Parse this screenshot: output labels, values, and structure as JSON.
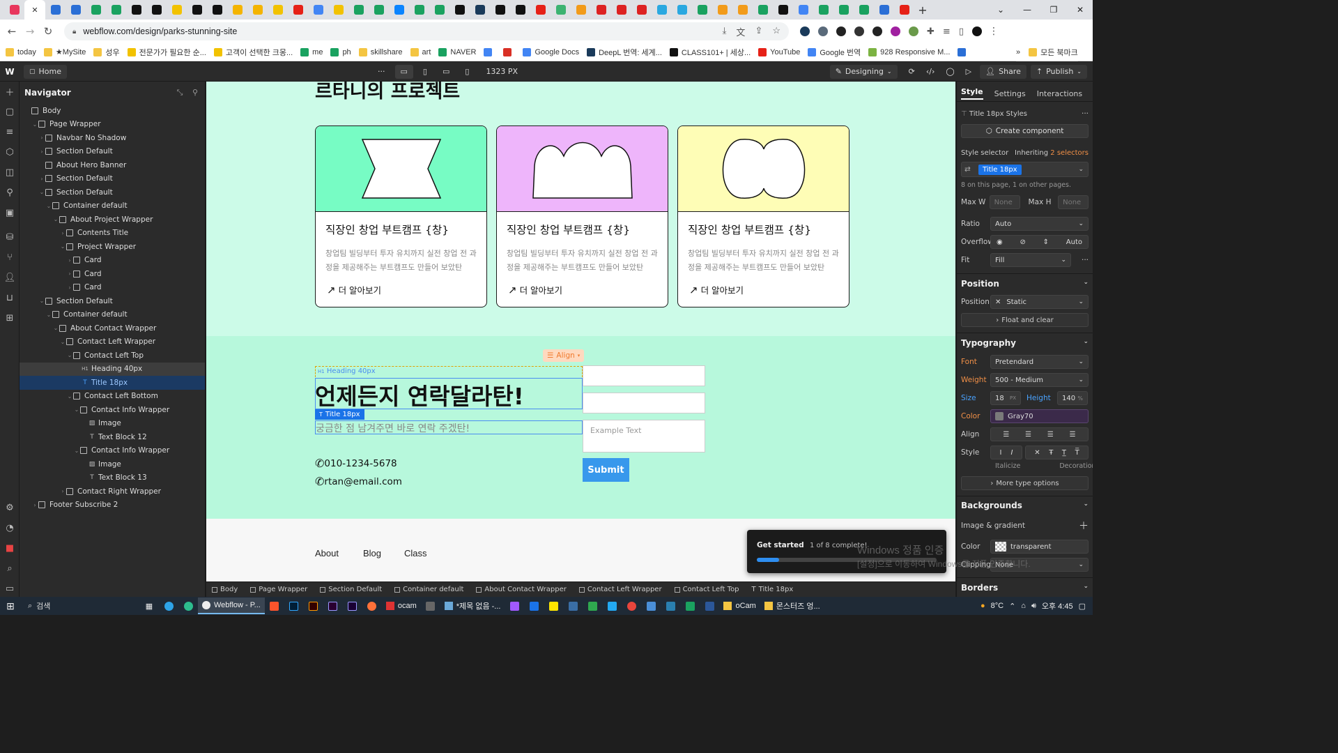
{
  "browser": {
    "url": "webflow.com/design/parks-stunning-site",
    "bookmarks": [
      "today",
      "★MySite",
      "성우",
      "전문가가 필요한 순...",
      "고객이 선택한 크몽...",
      "me",
      "ph",
      "skillshare",
      "art",
      "NAVER",
      "",
      "",
      "Google Docs",
      "DeepL 번역: 세계...",
      "CLASS101+ | 세상...",
      "YouTube",
      "Google 번역",
      "928 Responsive M...",
      ""
    ],
    "bookmarks_more": "»",
    "bookmarks_folder": "모든 북마크",
    "tab_colors": [
      "#e8365d",
      "#e8365d",
      "#2b6fd6",
      "#2b6fd6",
      "#1aa260",
      "#1aa260",
      "#111",
      "#111",
      "#f2c200",
      "#111",
      "#111",
      "#f4b400",
      "#f4b400",
      "#f2c200",
      "#e62117",
      "#4285f4",
      "#f2c200",
      "#1aa260",
      "#1aa260",
      "#0a84ff",
      "#1aa260",
      "#1aa260",
      "#111",
      "#1a3a5a",
      "#111",
      "#111",
      "#e62117",
      "#3cb371",
      "#f29b1a",
      "#d22",
      "#d22",
      "#d22",
      "#2aa8e0",
      "#2aa8e0",
      "#1aa260",
      "#f29b1a",
      "#f29b1a",
      "#1aa260",
      "#111",
      "#4285f4",
      "#1aa260",
      "#1aa260",
      "#1aa260",
      "#2b6fd6",
      "#e62117"
    ]
  },
  "webflow": {
    "home_label": "Home",
    "more": "···",
    "width_label": "1323 PX",
    "mode_label": "Designing",
    "share_label": "Share",
    "publish_label": "Publish"
  },
  "navigator": {
    "title": "Navigator",
    "items": [
      {
        "label": "Body",
        "depth": 0,
        "caret": "",
        "kind": "box"
      },
      {
        "label": "Page Wrapper",
        "depth": 1,
        "caret": "⌄",
        "kind": "box"
      },
      {
        "label": "Navbar No Shadow",
        "depth": 2,
        "caret": "›",
        "kind": "box"
      },
      {
        "label": "Section Default",
        "depth": 2,
        "caret": "›",
        "kind": "box"
      },
      {
        "label": "About Hero Banner",
        "depth": 2,
        "caret": "",
        "kind": "box"
      },
      {
        "label": "Section Default",
        "depth": 2,
        "caret": "›",
        "kind": "box"
      },
      {
        "label": "Section Default",
        "depth": 2,
        "caret": "⌄",
        "kind": "box"
      },
      {
        "label": "Container default",
        "depth": 3,
        "caret": "⌄",
        "kind": "box"
      },
      {
        "label": "About Project Wrapper",
        "depth": 4,
        "caret": "⌄",
        "kind": "box"
      },
      {
        "label": "Contents Title",
        "depth": 5,
        "caret": "›",
        "kind": "box"
      },
      {
        "label": "Project Wrapper",
        "depth": 5,
        "caret": "⌄",
        "kind": "box"
      },
      {
        "label": "Card",
        "depth": 6,
        "caret": "›",
        "kind": "box"
      },
      {
        "label": "Card",
        "depth": 6,
        "caret": "›",
        "kind": "box"
      },
      {
        "label": "Card",
        "depth": 6,
        "caret": "›",
        "kind": "box"
      },
      {
        "label": "Section Default",
        "depth": 2,
        "caret": "⌄",
        "kind": "box"
      },
      {
        "label": "Container default",
        "depth": 3,
        "caret": "⌄",
        "kind": "box"
      },
      {
        "label": "About Contact Wrapper",
        "depth": 4,
        "caret": "⌄",
        "kind": "box"
      },
      {
        "label": "Contact Left Wrapper",
        "depth": 5,
        "caret": "⌄",
        "kind": "box"
      },
      {
        "label": "Contact Left Top",
        "depth": 6,
        "caret": "⌄",
        "kind": "box"
      },
      {
        "label": "Heading 40px",
        "depth": 7,
        "caret": "",
        "kind": "H1",
        "state": "parent"
      },
      {
        "label": "Title 18px",
        "depth": 7,
        "caret": "",
        "kind": "T",
        "state": "selected"
      },
      {
        "label": "Contact Left Bottom",
        "depth": 6,
        "caret": "⌄",
        "kind": "box"
      },
      {
        "label": "Contact Info Wrapper",
        "depth": 7,
        "caret": "⌄",
        "kind": "box"
      },
      {
        "label": "Image",
        "depth": 8,
        "caret": "",
        "kind": "img"
      },
      {
        "label": "Text Block 12",
        "depth": 8,
        "caret": "",
        "kind": "T"
      },
      {
        "label": "Contact Info Wrapper",
        "depth": 7,
        "caret": "⌄",
        "kind": "box"
      },
      {
        "label": "Image",
        "depth": 8,
        "caret": "",
        "kind": "img"
      },
      {
        "label": "Text Block 13",
        "depth": 8,
        "caret": "",
        "kind": "T"
      },
      {
        "label": "Contact Right Wrapper",
        "depth": 5,
        "caret": "›",
        "kind": "box"
      },
      {
        "label": "Footer Subscribe 2",
        "depth": 1,
        "caret": "›",
        "kind": "box"
      }
    ]
  },
  "canvas": {
    "section_title": "르타니의 프로젝트",
    "cards": [
      {
        "title": "직장인 창업 부트캠프 {창}",
        "desc": "창업팀 빌딩부터 투자 유치까지 실전 창업 전 과정을 제공해주는 부트캠프도 만들어 보았탄",
        "more": "더 알아보기",
        "color": "#77fcc4"
      },
      {
        "title": "직장인 창업 부트캠프 {창}",
        "desc": "창업팀 빌딩부터 투자 유치까지 실전 창업 전 과정을 제공해주는 부트캠프도 만들어 보았탄",
        "more": "더 알아보기",
        "color": "#eeb5fb"
      },
      {
        "title": "직장인 창업 부트캠프 {창}",
        "desc": "창업팀 빌딩부터 투자 유치까지 실전 창업 전 과정을 제공해주는 부트캠프도 만들어 보았탄",
        "more": "더 알아보기",
        "color": "#fefdb6"
      }
    ],
    "align_badge": "Align",
    "heading_badge": "Heading 40px",
    "title_badge": "Title 18px",
    "contact_heading": "언제든지 연락달라탄!",
    "contact_sub": "궁금한 점 남겨주면 바로 연락 주겠탄!",
    "phone": "010-1234-5678",
    "email": "rtan@email.com",
    "textarea_placeholder": "Example Text",
    "submit_label": "Submit",
    "footer_links": [
      "About",
      "Blog",
      "Class"
    ]
  },
  "breadcrumbs": [
    "Body",
    "Page Wrapper",
    "Section Default",
    "Container default",
    "About Contact Wrapper",
    "Contact Left Wrapper",
    "Contact Left Top",
    "Title 18px"
  ],
  "panel": {
    "tabs": [
      "Style",
      "Settings",
      "Interactions"
    ],
    "styles_title": "Title 18px Styles",
    "create_component": "Create component",
    "style_selector_label": "Style selector",
    "inheriting_prefix": "Inheriting",
    "inheriting_link": "2 selectors",
    "selector_chip": "Title 18px",
    "selector_note": "8 on this page, 1 on other pages.",
    "max_w_label": "Max W",
    "max_w_value": "None",
    "max_h_label": "Max H",
    "max_h_value": "None",
    "ratio_label": "Ratio",
    "ratio_value": "Auto",
    "overflow_label": "Overflow",
    "overflow_auto": "Auto",
    "fit_label": "Fit",
    "fit_value": "Fill",
    "position_head": "Position",
    "position_label": "Position",
    "position_value": "Static",
    "float_clear": "Float and clear",
    "typography_head": "Typography",
    "font_label": "Font",
    "font_value": "Pretendard",
    "weight_label": "Weight",
    "weight_value": "500 - Medium",
    "size_label": "Size",
    "size_value": "18",
    "size_unit": "PX",
    "height_label": "Height",
    "height_value": "140",
    "height_unit": "%",
    "color_label": "Color",
    "color_value": "Gray70",
    "align_label": "Align",
    "style_label": "Style",
    "italicize_label": "Italicize",
    "decoration_label": "Decoration",
    "more_type": "More type options",
    "backgrounds_head": "Backgrounds",
    "image_gradient": "Image & gradient",
    "bg_color_label": "Color",
    "bg_color_value": "transparent",
    "clipping_label": "Clipping",
    "clipping_value": "None",
    "borders_head": "Borders"
  },
  "toast": {
    "title": "Get started",
    "progress_text": "1 of 8 complete!",
    "progress_fraction": 0.125
  },
  "watermark": {
    "line1": "Windows 정품 인증",
    "line2": "[설정]으로 이동하여 Windows를 정품 인증합니다."
  },
  "taskbar": {
    "search": "검색",
    "apps": [
      "Webflow - P...",
      "ocam",
      "*제목 없음 -...",
      "oCam",
      "몬스터즈 엉..."
    ],
    "weather": "8°C",
    "time": "오후 4:45"
  }
}
